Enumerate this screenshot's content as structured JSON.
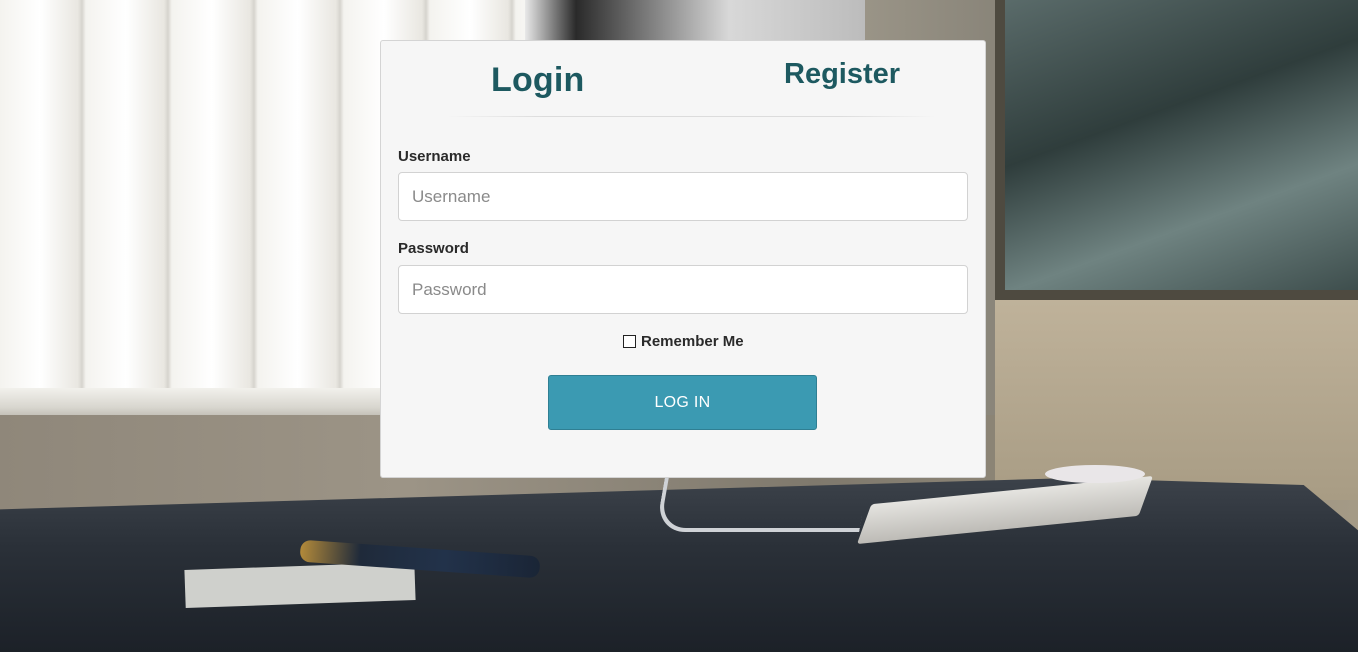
{
  "tabs": {
    "login": "Login",
    "register": "Register"
  },
  "form": {
    "username_label": "Username",
    "username_placeholder": "Username",
    "username_value": "",
    "password_label": "Password",
    "password_placeholder": "Password",
    "password_value": "",
    "remember_label": "Remember Me",
    "remember_checked": false,
    "submit_label": "LOG IN"
  },
  "colors": {
    "accent": "#1d5960",
    "button": "#3b9ab2",
    "panel_bg": "#f6f6f6"
  }
}
